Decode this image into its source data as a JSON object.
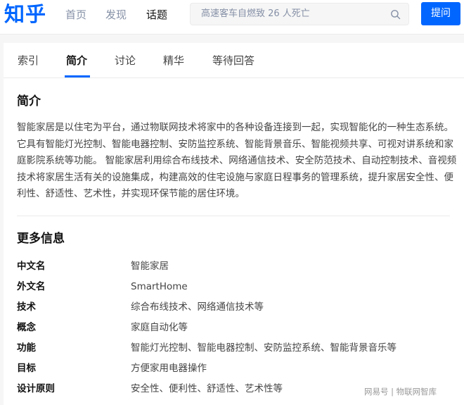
{
  "header": {
    "logo": "知乎",
    "nav": [
      {
        "label": "首页",
        "active": false
      },
      {
        "label": "发现",
        "active": false
      },
      {
        "label": "话题",
        "active": true
      }
    ],
    "search": {
      "placeholder": "高速客车自燃致 26 人死亡",
      "icon": "search-icon"
    },
    "ask_label": "提问"
  },
  "colors": {
    "brand": "#0066ff",
    "muted": "#8590a6",
    "text": "#444444"
  },
  "tabs": [
    {
      "label": "索引",
      "active": false
    },
    {
      "label": "简介",
      "active": true
    },
    {
      "label": "讨论",
      "active": false
    },
    {
      "label": "精华",
      "active": false
    },
    {
      "label": "等待回答",
      "active": false
    }
  ],
  "intro": {
    "title": "简介",
    "text": "智能家居是以住宅为平台，通过物联网技术将家中的各种设备连接到一起，实现智能化的一种生态系统。它具有智能灯光控制、智能电器控制、安防监控系统、智能背景音乐、智能视频共享、可视对讲系统和家庭影院系统等功能。 智能家居利用综合布线技术、网络通信技术、安全防范技术、自动控制技术、音视频技术将家居生活有关的设施集成，构建高效的住宅设施与家庭日程事务的管理系统，提升家居安全性、便利性、舒适性、艺术性，并实现环保节能的居住环境。"
  },
  "more": {
    "title": "更多信息",
    "rows": [
      {
        "label": "中文名",
        "value": "智能家居"
      },
      {
        "label": "外文名",
        "value": "SmartHome"
      },
      {
        "label": "技术",
        "value": "综合布线技术、网络通信技术等"
      },
      {
        "label": "概念",
        "value": "家庭自动化等"
      },
      {
        "label": "功能",
        "value": "智能灯光控制、智能电器控制、安防监控系统、智能背景音乐等"
      },
      {
        "label": "目标",
        "value": "方便家用电器操作"
      },
      {
        "label": "设计原则",
        "value": "安全性、便利性、舒适性、艺术性等"
      }
    ]
  },
  "watermark": "网易号 | 物联网智库"
}
